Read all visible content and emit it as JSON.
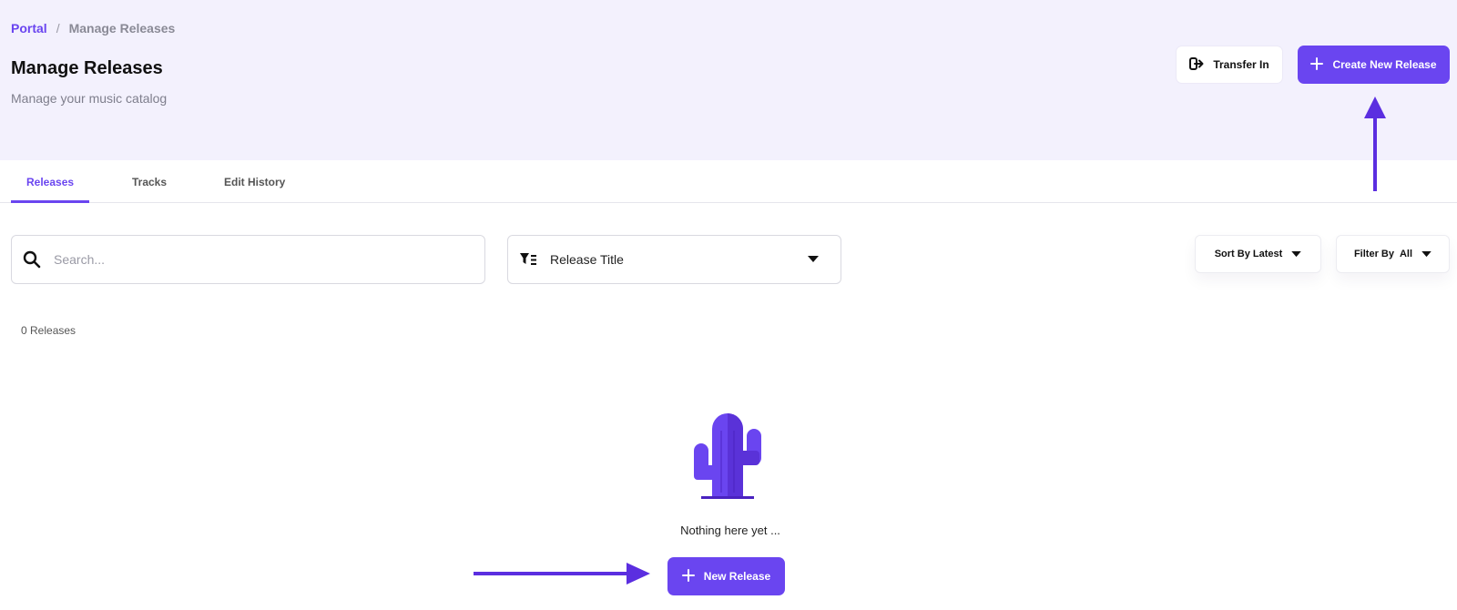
{
  "breadcrumb": {
    "root": "Portal",
    "separator": "/",
    "current": "Manage Releases"
  },
  "page": {
    "title": "Manage Releases",
    "subtitle": "Manage your music catalog"
  },
  "actions": {
    "transfer_label": "Transfer In",
    "create_label": "Create New Release"
  },
  "tabs": [
    {
      "label": "Releases",
      "active": true
    },
    {
      "label": "Tracks",
      "active": false
    },
    {
      "label": "Edit History",
      "active": false
    }
  ],
  "search": {
    "placeholder": "Search...",
    "value": ""
  },
  "search_field": {
    "selected": "Release Title"
  },
  "sort": {
    "label": "Sort By Latest"
  },
  "filter": {
    "label": "Filter By",
    "value": "All"
  },
  "results": {
    "count_label": "0 Releases"
  },
  "empty_state": {
    "message": "Nothing here yet ...",
    "button_label": "New Release",
    "icon": "cactus-icon"
  },
  "colors": {
    "accent": "#6a45f0",
    "header_bg": "#f3f1fd",
    "annotation_arrow": "#5b2ee0"
  }
}
